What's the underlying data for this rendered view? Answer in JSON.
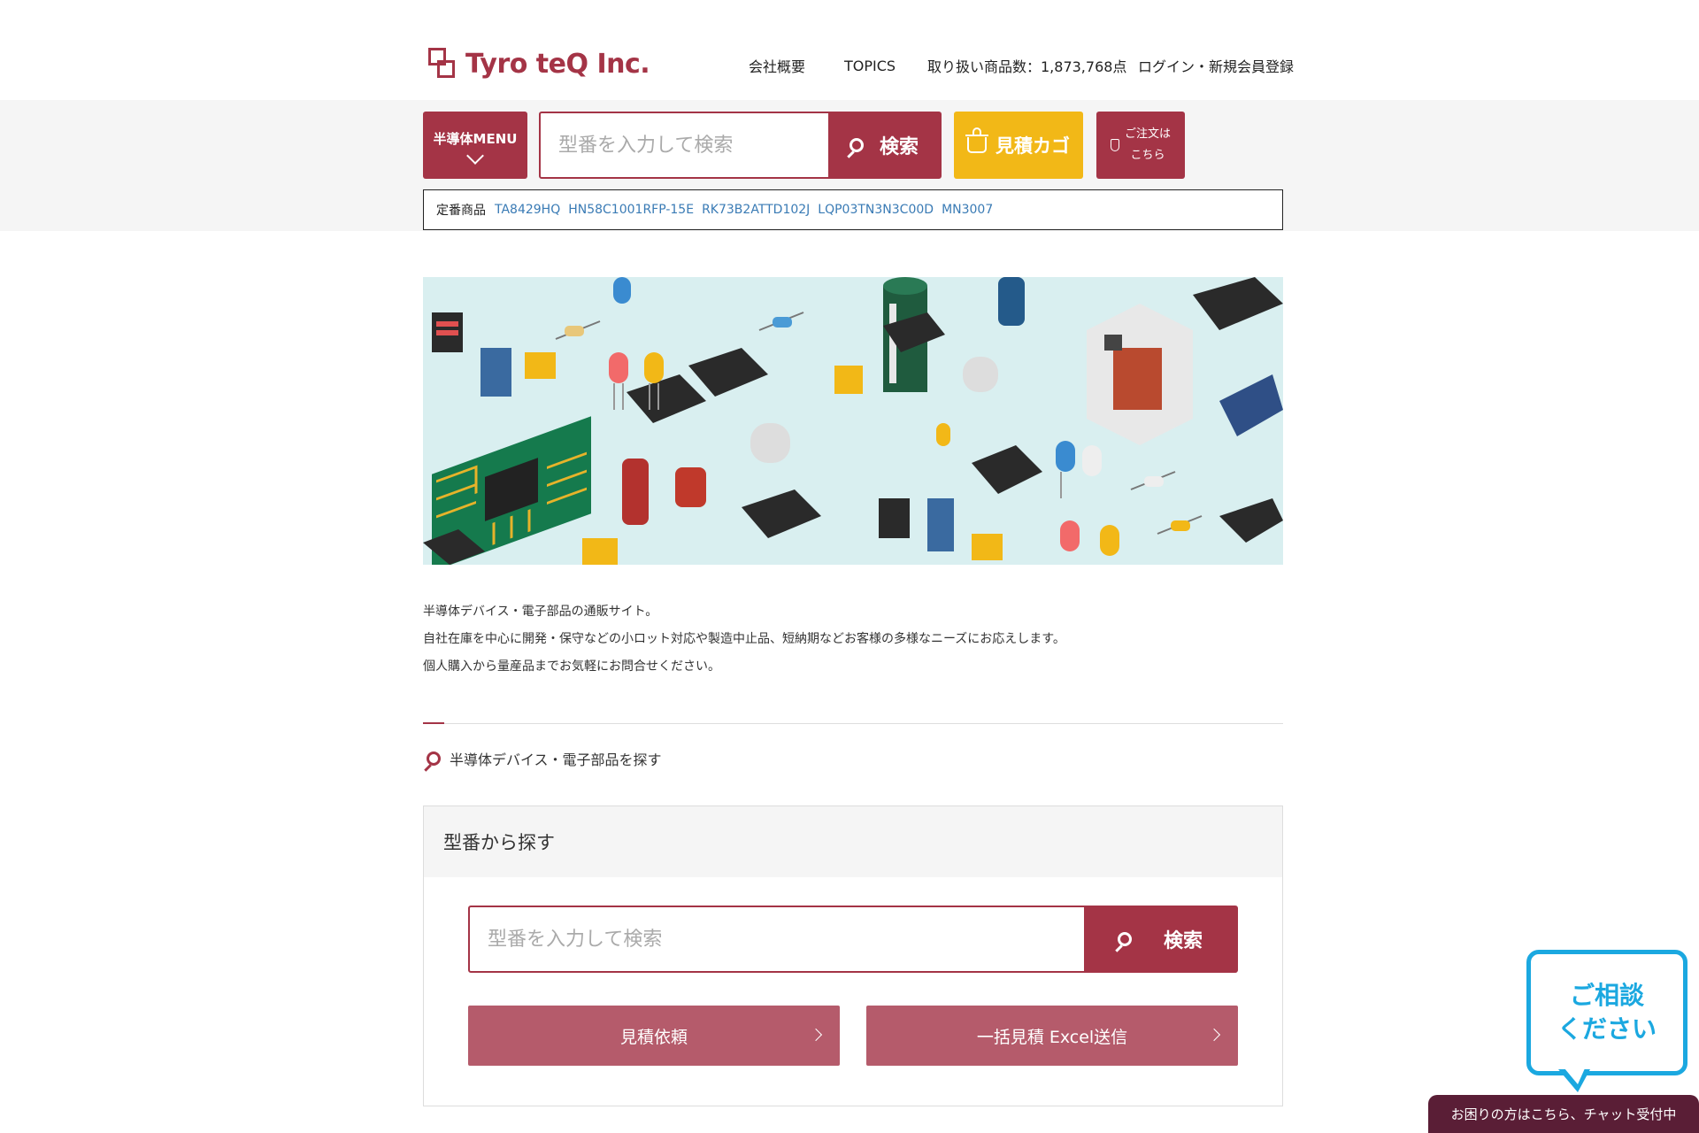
{
  "header": {
    "logo_text": "Tyro teQ Inc.",
    "nav": [
      {
        "label": "会社概要"
      },
      {
        "label": "TOPICS"
      },
      {
        "label": "取り扱い商品数：1,873,768点"
      },
      {
        "label": "ログイン・新規会員登録"
      }
    ]
  },
  "toolbar": {
    "menu_label": "半導体MENU",
    "search_placeholder": "型番を入力して検索",
    "search_button": "検索",
    "cart_label": "見積カゴ",
    "order_line1": "ご注文は",
    "order_line2": "こちら"
  },
  "popular": {
    "label": "定番商品",
    "items": [
      "TA8429HQ",
      "HN58C1001RFP-15E",
      "RK73B2ATTD102J",
      "LQP03TN3N3C00D",
      "MN3007"
    ]
  },
  "intro": {
    "line1": "半導体デバイス・電子部品の通販サイト。",
    "line2": "自社在庫を中心に開発・保守などの小ロット対応や製造中止品、短納期などお客様の多様なニーズにお応えします。",
    "line3": "個人購入から量産品までお気軽にお問合せください。"
  },
  "section": {
    "title": "半導体デバイス・電子部品を探す"
  },
  "panel": {
    "title": "型番から探す",
    "search_placeholder": "型番を入力して検索",
    "search_button": "検索",
    "quote_button": "見積依頼",
    "excel_button": "一括見積 Excel送信"
  },
  "chat": {
    "bubble_line1": "ご相談",
    "bubble_line2": "ください",
    "bar_text": "お困りの方はこちら、チャット受付中"
  },
  "colors": {
    "brand": "#a43446",
    "accent_yellow": "#f2b817",
    "link_blue": "#3a7bb5",
    "chat_blue": "#1ba8e0",
    "chat_bar": "#5a1e36"
  }
}
